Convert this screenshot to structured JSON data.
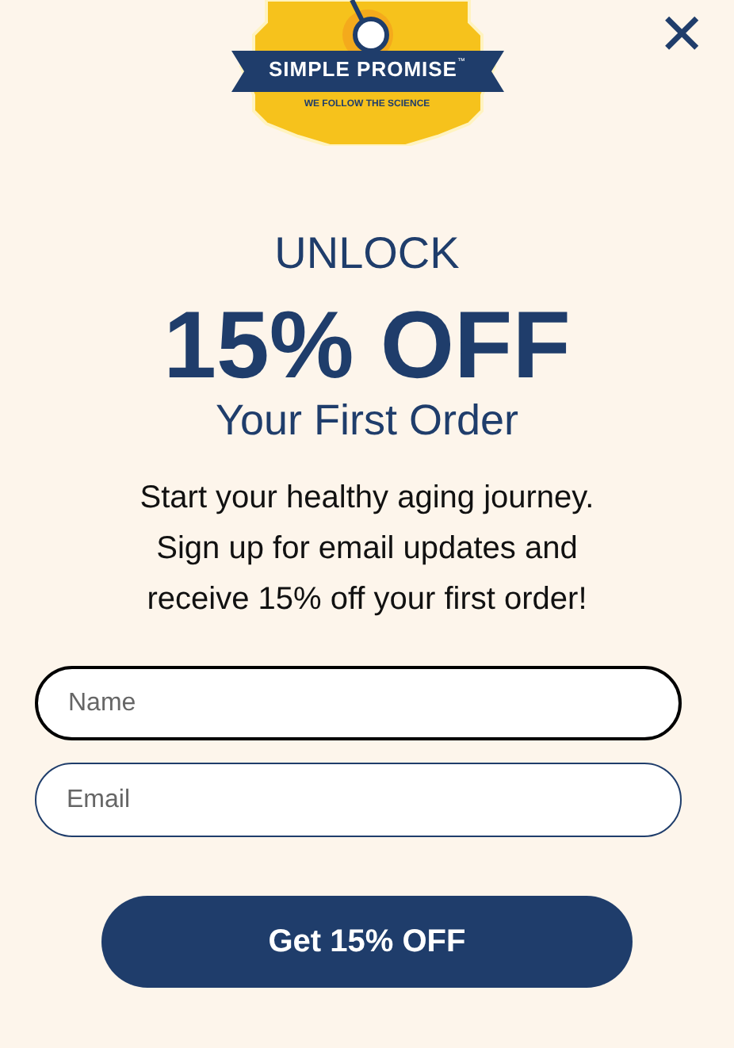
{
  "logo": {
    "name": "SIMPLE PROMISE",
    "trademark": "™",
    "tagline": "WE FOLLOW THE SCIENCE"
  },
  "close": {
    "label": "✕"
  },
  "headline": {
    "eyebrow": "UNLOCK",
    "offer": "15% OFF",
    "subtitle": "Your First Order"
  },
  "message_lines": [
    "Start your healthy aging journey.",
    "Sign up for email updates and",
    "receive 15% off your first order!"
  ],
  "fields": [
    {
      "placeholder": "Name",
      "selected": true
    },
    {
      "placeholder": "Email",
      "selected": false
    }
  ],
  "submit": {
    "label": "Get 15% OFF"
  }
}
